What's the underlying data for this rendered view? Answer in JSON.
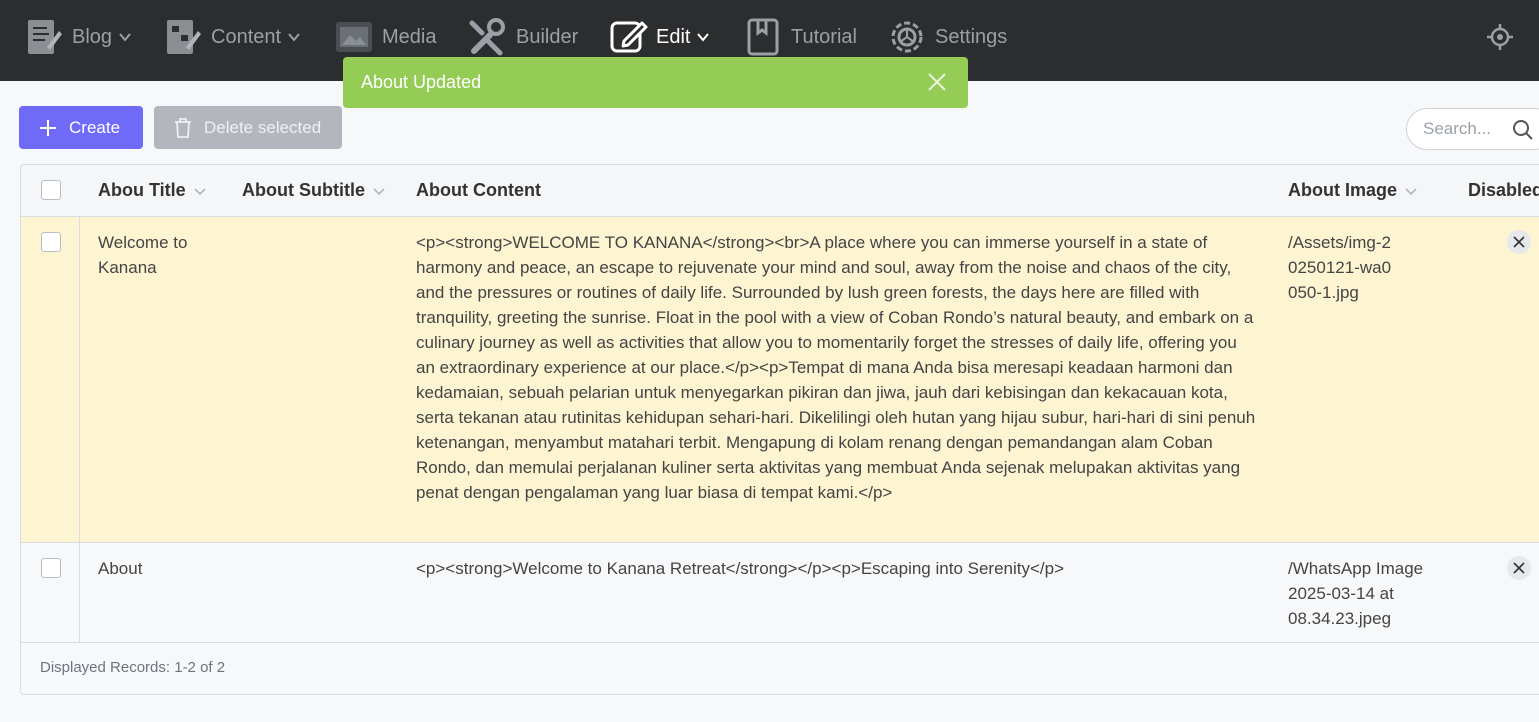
{
  "nav": {
    "items": [
      {
        "label": "Blog",
        "icon": "blog-icon",
        "dropdown": true
      },
      {
        "label": "Content",
        "icon": "content-icon",
        "dropdown": true
      },
      {
        "label": "Media",
        "icon": "media-icon",
        "dropdown": false
      },
      {
        "label": "Builder",
        "icon": "builder-icon",
        "dropdown": false
      },
      {
        "label": "Edit",
        "icon": "edit-icon",
        "dropdown": true,
        "active": true
      },
      {
        "label": "Tutorial",
        "icon": "tutorial-icon",
        "dropdown": false
      },
      {
        "label": "Settings",
        "icon": "settings-icon",
        "dropdown": false
      }
    ],
    "right_icon": "crosshair-icon"
  },
  "toast": {
    "message": "About Updated",
    "color": "#95cc55"
  },
  "toolbar": {
    "create_label": "Create",
    "delete_label": "Delete selected",
    "search_placeholder": "Search..."
  },
  "table": {
    "columns": [
      "Abou Title",
      "About Subtitle",
      "About Content",
      "About Image",
      "Disabled"
    ],
    "rows": [
      {
        "title": "Welcome to Kanana",
        "subtitle": "",
        "content": "<p><strong>WELCOME TO KANANA</strong><br>A place where you can immerse yourself in a state of harmony and peace, an escape to rejuvenate your mind and soul, away from the noise and chaos of the city, and the pressures or routines of daily life. Surrounded by lush green forests, the days here are filled with tranquility, greeting the sunrise. Float in the pool with a view of Coban Rondo’s natural beauty, and embark on a culinary journey as well as activities that allow you to momentarily forget the stresses of daily life, offering you an extraordinary experience at our place.</p><p>Tempat di mana Anda bisa meresapi keadaan harmoni dan kedamaian, sebuah pelarian untuk menyegarkan pikiran dan jiwa, jauh dari kebisingan dan kekacauan kota, serta tekanan atau rutinitas kehidupan sehari-hari. Dikelilingi oleh hutan yang hijau subur, hari-hari di sini penuh ketenangan, menyambut matahari terbit. Mengapung di kolam renang dengan pemandangan alam Coban Rondo, dan memulai perjalanan kuliner serta aktivitas yang membuat Anda sejenak melupakan aktivitas yang penat dengan pengalaman yang luar biasa di tempat kami.</p>",
        "image": "/Assets/img-20250121-wa0050-1.jpg"
      },
      {
        "title": "About",
        "subtitle": "",
        "content": "<p><strong>Welcome to Kanana Retreat</strong></p><p>Escaping into Serenity</p>",
        "image": "/WhatsApp Image 2025-03-14 at 08.34.23.jpeg"
      }
    ],
    "footer": "Displayed Records: 1-2 of 2",
    "highlight_color": "#fdf5d2"
  },
  "colors": {
    "accent": "#6f6af8",
    "topbar": "#2b2d2f",
    "toast": "#95cc55"
  }
}
